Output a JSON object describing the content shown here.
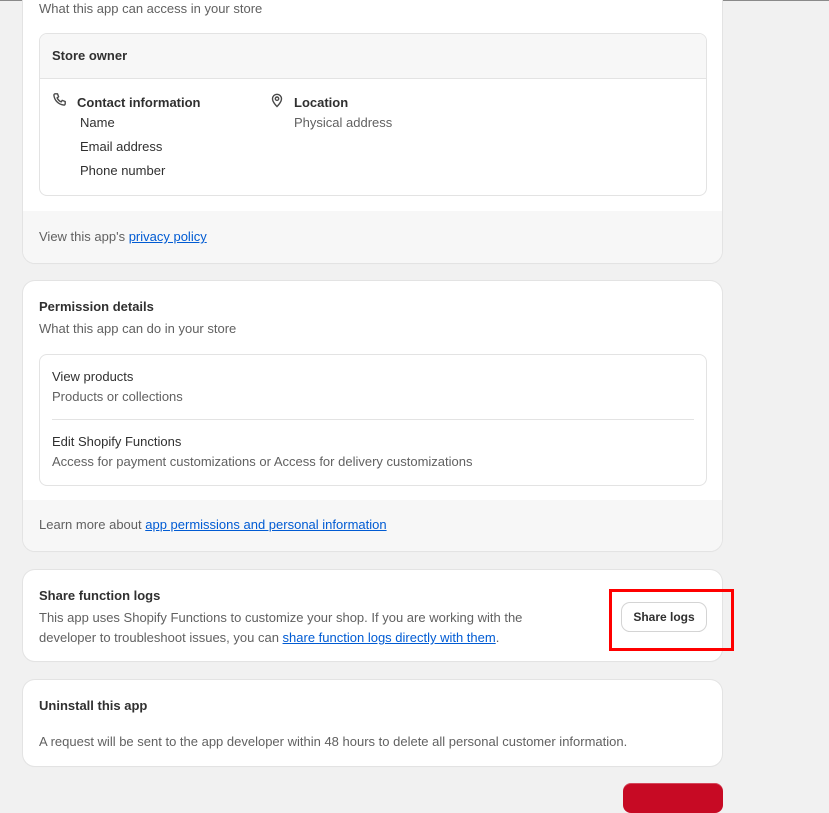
{
  "access_card": {
    "subtitle": "What this app can access in your store",
    "owner_box": {
      "header": "Store owner",
      "contact": {
        "icon": "phone-icon",
        "title": "Contact information",
        "items": [
          "Name",
          "Email address",
          "Phone number"
        ]
      },
      "location": {
        "icon": "location-pin-icon",
        "title": "Location",
        "items": [
          "Physical address"
        ]
      }
    },
    "footer": {
      "prefix": "View this app's ",
      "link": "privacy policy"
    }
  },
  "permissions_card": {
    "title": "Permission details",
    "subtitle": "What this app can do in your store",
    "permissions": [
      {
        "name": "View products",
        "detail": "Products or collections"
      },
      {
        "name": "Edit Shopify Functions",
        "detail": "Access for payment customizations or Access for delivery customizations"
      }
    ],
    "footer": {
      "prefix": "Learn more about ",
      "link": "app permissions and personal information"
    }
  },
  "logs_card": {
    "title": "Share function logs",
    "description": "This app uses Shopify Functions to customize your shop. If you are working with the developer to troubleshoot issues, you can ",
    "link": "share function logs directly with them",
    "suffix": ".",
    "button_label": "Share logs"
  },
  "uninstall_card": {
    "title": "Uninstall this app",
    "description": "A request will be sent to the app developer within 48 hours to delete all personal customer information."
  },
  "colors": {
    "background": "#f1f1f1",
    "link": "#005bd3",
    "highlight": "#ff0000",
    "danger": "#c70a24"
  }
}
